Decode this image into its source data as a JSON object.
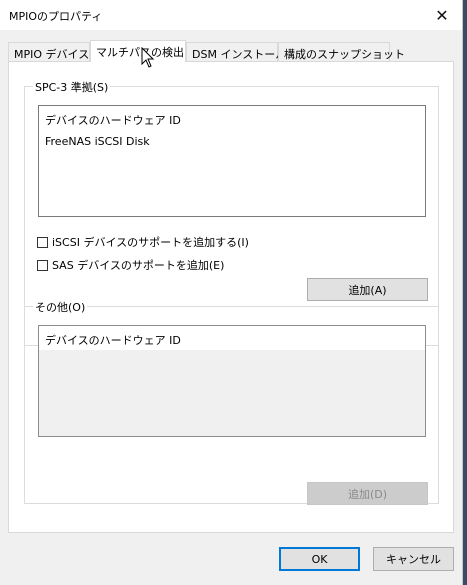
{
  "window": {
    "title": "MPIOのプロパティ",
    "close_glyph": "✕"
  },
  "tabs": [
    {
      "label": "MPIO デバイス",
      "selected": false
    },
    {
      "label": "マルチパスの検出",
      "selected": true
    },
    {
      "label": "DSM インストール",
      "selected": false
    },
    {
      "label": "構成のスナップショット",
      "selected": false
    }
  ],
  "spc3": {
    "label": "SPC-3 準拠(S)",
    "list_header": "デバイスのハードウェア ID",
    "items": [
      "FreeNAS iSCSI Disk"
    ],
    "checkbox_iscsi": {
      "label": "iSCSI デバイスのサポートを追加する(I)",
      "checked": false
    },
    "checkbox_sas": {
      "label": "SAS デバイスのサポートを追加(E)",
      "checked": false
    },
    "add_button": "追加(A)"
  },
  "others": {
    "label": "その他(O)",
    "list_header": "デバイスのハードウェア ID",
    "add_button": "追加(D)"
  },
  "footer": {
    "ok_label": "OK",
    "cancel_label": "キャンセル"
  },
  "colors": {
    "accent": "#0078d7",
    "window_bg": "#f0f0f0",
    "panel_bg": "#ffffff"
  }
}
